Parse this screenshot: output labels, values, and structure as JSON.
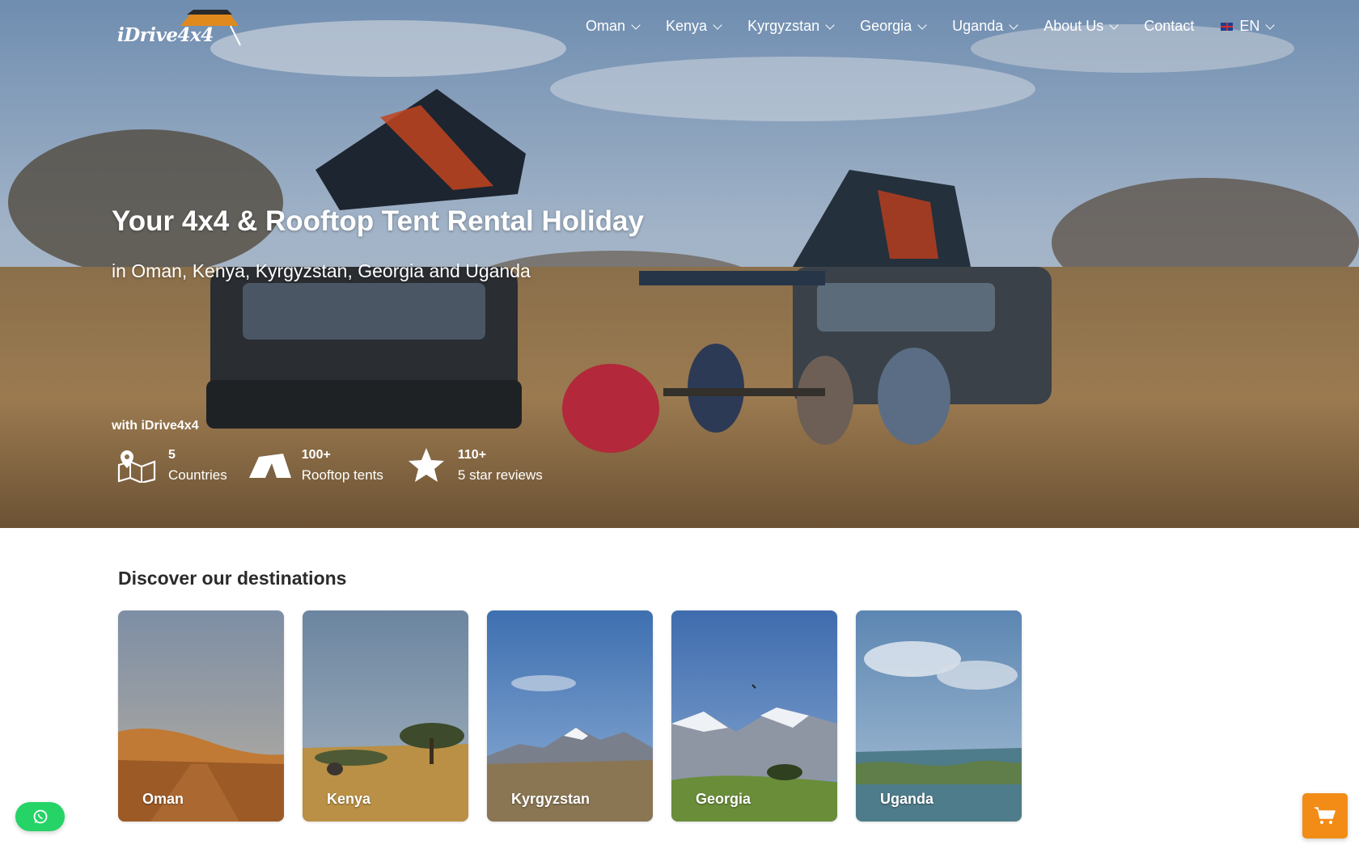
{
  "brand": {
    "logo_text": "iDrive4x4"
  },
  "nav": {
    "items": [
      {
        "label": "Oman",
        "has_dropdown": true
      },
      {
        "label": "Kenya",
        "has_dropdown": true
      },
      {
        "label": "Kyrgyzstan",
        "has_dropdown": true
      },
      {
        "label": "Georgia",
        "has_dropdown": true
      },
      {
        "label": "Uganda",
        "has_dropdown": true
      },
      {
        "label": "About Us",
        "has_dropdown": true
      },
      {
        "label": "Contact",
        "has_dropdown": false
      }
    ],
    "language": {
      "label": "EN",
      "flag_icon": "uk-flag-icon"
    }
  },
  "hero": {
    "title": "Your 4x4 & Rooftop Tent Rental Holiday",
    "subtitle": "in Oman, Kenya, Kyrgyzstan, Georgia and Uganda",
    "with_label": "with iDrive4x4",
    "stats": [
      {
        "icon": "map-pin-icon",
        "number": "5",
        "label": "Countries"
      },
      {
        "icon": "tent-icon",
        "number": "100+",
        "label": "Rooftop tents"
      },
      {
        "icon": "star-icon",
        "number": "110+",
        "label": "5 star reviews"
      }
    ]
  },
  "destinations": {
    "title": "Discover our destinations",
    "cards": [
      {
        "label": "Oman"
      },
      {
        "label": "Kenya"
      },
      {
        "label": "Kyrgyzstan"
      },
      {
        "label": "Georgia"
      },
      {
        "label": "Uganda"
      }
    ]
  },
  "floating": {
    "whatsapp_icon": "whatsapp-icon",
    "cart_icon": "cart-icon"
  },
  "colors": {
    "whatsapp": "#25d366",
    "cart": "#f28c16",
    "text_dark": "#2b2b2b",
    "white": "#ffffff"
  }
}
